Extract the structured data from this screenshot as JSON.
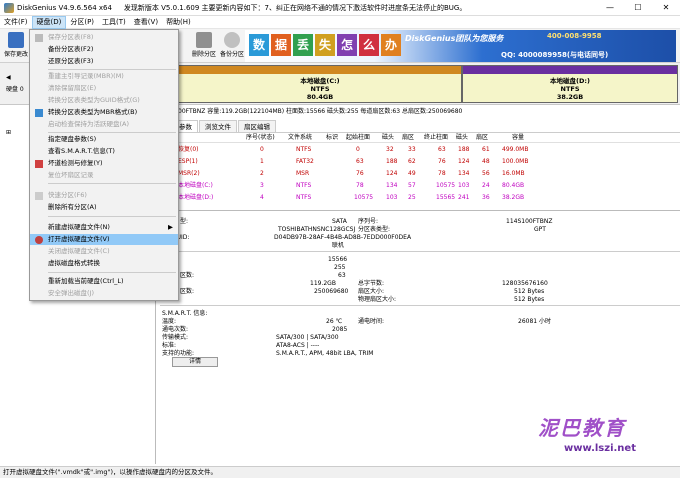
{
  "window": {
    "title": "DiskGenius V4.9.6.564 x64",
    "notice": "发现新版本 V5.0.1.609 主要更新内容如下：7、纠正在网络不通的情况下激活软件时进度条无法停止的BUG。",
    "min": "—",
    "max": "☐",
    "close": "✕"
  },
  "menubar": [
    "文件(F)",
    "硬盘(D)",
    "分区(P)",
    "工具(T)",
    "查看(V)",
    "帮助(H)"
  ],
  "toolbar": {
    "save": "保存更改",
    "delete": "删除分区",
    "backup": "备份分区"
  },
  "banner": {
    "chars": [
      "数",
      "据",
      "丢",
      "失",
      "怎",
      "么",
      "办"
    ],
    "brand": "DiskGenius团队为您服务",
    "phone": "400-008-9958",
    "qq": "QQ: 4000089958(与电话同号)"
  },
  "diskmap": {
    "left_label": "硬盘 0",
    "c": {
      "name": "本地磁盘(C:)",
      "fs": "NTFS",
      "size": "80.4GB"
    },
    "d": {
      "name": "本地磁盘(D:)",
      "fs": "NTFS",
      "size": "38.2GB"
    }
  },
  "infoline": "00FTBNZ  容量:119.2GB(122104MB)  柱面数:15566  磁头数:255  每道扇区数:63  总扇区数:250069680",
  "tabs": [
    "分区参数",
    "浏览文件",
    "扇区编辑"
  ],
  "table": {
    "headers": [
      "序号(状态)",
      "文件系统",
      "标识",
      "起始柱面",
      "磁头",
      "扇区",
      "终止柱面",
      "磁头",
      "扇区",
      "容量"
    ],
    "rows": [
      {
        "name": "恢复(0)",
        "no": "0",
        "fs": "NTFS",
        "id": "",
        "sc": "0",
        "sh": "32",
        "ss": "33",
        "ec": "63",
        "eh": "188",
        "es": "61",
        "cap": "499.0MB"
      },
      {
        "name": "ESP(1)",
        "no": "1",
        "fs": "FAT32",
        "id": "",
        "sc": "63",
        "sh": "188",
        "ss": "62",
        "ec": "76",
        "eh": "124",
        "es": "48",
        "cap": "100.0MB"
      },
      {
        "name": "MSR(2)",
        "no": "2",
        "fs": "MSR",
        "id": "",
        "sc": "76",
        "sh": "124",
        "ss": "49",
        "ec": "78",
        "eh": "134",
        "es": "56",
        "cap": "16.0MB"
      },
      {
        "name": "本地磁盘(C:)",
        "no": "3",
        "fs": "NTFS",
        "id": "",
        "sc": "78",
        "sh": "134",
        "ss": "57",
        "ec": "10575",
        "eh": "103",
        "es": "24",
        "cap": "80.4GB"
      },
      {
        "name": "本地磁盘(D:)",
        "no": "4",
        "fs": "NTFS",
        "id": "",
        "sc": "10575",
        "sh": "103",
        "ss": "25",
        "ec": "15565",
        "eh": "241",
        "es": "36",
        "cap": "38.2GB"
      }
    ]
  },
  "details": {
    "type_label": "型:",
    "type_val": "SATA",
    "model_val": "TOSHIBATHNSNC128GCSJ",
    "guid_label": "GUID:",
    "guid_val": "D04DB97B-28AF-4B4B-AD8B-7EDD000F0DEA",
    "state_val": "联机",
    "sn_label": "序列号:",
    "sn_val": "114S100FTBNZ",
    "pt_label": "分区表类型:",
    "pt_val": "GPT",
    "cyl_val": "15566",
    "heads_val": "255",
    "spt_label": "区数:",
    "spt_val": "63",
    "cap_val": "119.2GB",
    "total_sect_label": "区数:",
    "total_sect_val": "250069680",
    "bytes_label": "总字节数:",
    "bytes_val": "128035676160",
    "sect_size_label": "扇区大小:",
    "sect_size_val": "512 Bytes",
    "phys_label": "物理扇区大小:",
    "phys_val": "512 Bytes",
    "smart_label": "S.M.A.R.T. 信息:",
    "temp_label": "温度:",
    "temp_val": "26 ℃",
    "powerc_label": "通电次数:",
    "powerc_val": "2085",
    "powert_label": "通电时间:",
    "powert_val": "26081 小时",
    "xfer_label": "传输模式:",
    "xfer_val": "SATA/300 | SATA/300",
    "std_label": "标准:",
    "std_val": "ATA8-ACS | ----",
    "feat_label": "支持的功能:",
    "feat_val": "S.M.A.R.T., APM, 48bit LBA, TRIM",
    "detail_btn": "详情"
  },
  "menu": {
    "items": [
      {
        "label": "保存分区表(F8)",
        "disabled": true
      },
      {
        "label": "备份分区表(F2)",
        "disabled": false
      },
      {
        "label": "还原分区表(F3)",
        "disabled": false
      },
      {
        "label": "重建主引导记录(MBR)(M)",
        "disabled": true
      },
      {
        "label": "清除保留扇区(E)",
        "disabled": true
      },
      {
        "label": "转换分区表类型为GUID格式(G)",
        "disabled": true
      },
      {
        "label": "转换分区表类型为MBR格式(B)",
        "disabled": false
      },
      {
        "label": "启动检查保持为活跃硬盘(A)",
        "disabled": true
      },
      {
        "label": "指定硬盘参数(S)",
        "disabled": false
      },
      {
        "label": "查看S.M.A.R.T.信息(T)",
        "disabled": false
      },
      {
        "label": "坏道检测与修复(Y)",
        "disabled": false
      },
      {
        "label": "复位坏扇区记录",
        "disabled": true
      },
      {
        "label": "快速分区(F6)",
        "disabled": true
      },
      {
        "label": "删除所有分区(A)",
        "disabled": false
      },
      {
        "label": "新建虚拟硬盘文件(N)",
        "disabled": false,
        "arrow": "▶"
      },
      {
        "label": "打开虚拟硬盘文件(V)",
        "disabled": false
      },
      {
        "label": "关闭虚拟硬盘文件(C)",
        "disabled": true
      },
      {
        "label": "虚拟磁盘格式转换",
        "disabled": false
      },
      {
        "label": "重新加载当前硬盘(Ctrl_L)",
        "disabled": false
      },
      {
        "label": "安全弹出磁盘(J)",
        "disabled": true
      }
    ]
  },
  "statusbar": "打开虚拟硬盘文件(\".vmdk\"或\".img\")，以操作虚拟硬盘内的分区及文件。",
  "watermark": {
    "text": "泥巴教育",
    "url": "www.lszi.net"
  }
}
